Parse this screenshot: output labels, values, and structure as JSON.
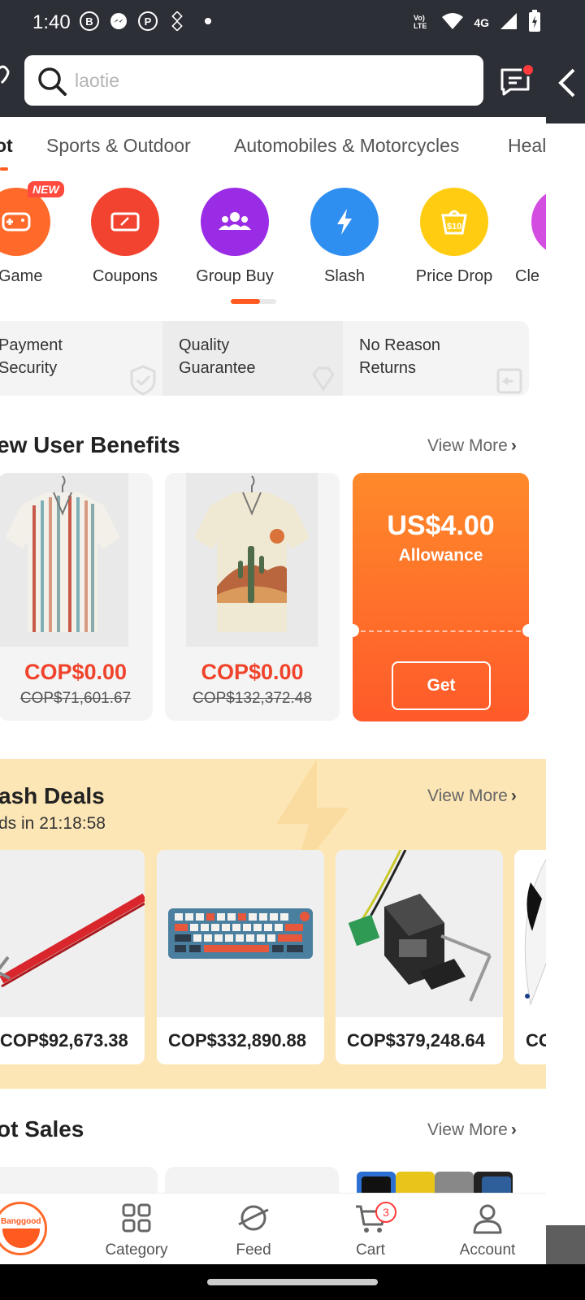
{
  "status_bar": {
    "time": "1:40",
    "network": "4G"
  },
  "search": {
    "placeholder": "laotie"
  },
  "category_tabs": [
    "ot",
    "Sports & Outdoor",
    "Automobiles & Motorcycles",
    "Heal"
  ],
  "quick_icons": [
    {
      "label": "Game",
      "color": "#ff6a2a",
      "badge": "NEW"
    },
    {
      "label": "Coupons",
      "color": "#f1432f"
    },
    {
      "label": "Group Buy",
      "color": "#9b2ce6"
    },
    {
      "label": "Slash",
      "color": "#2f8ff0"
    },
    {
      "label": "Price Drop",
      "color": "#ffcc12"
    },
    {
      "label": "Cle",
      "color": "#d34de0"
    }
  ],
  "guarantees": [
    {
      "line1": "Payment",
      "line2": "Security"
    },
    {
      "line1": "Quality",
      "line2": "Guarantee"
    },
    {
      "line1": "No Reason",
      "line2": "Returns"
    }
  ],
  "new_user": {
    "title": "ew User Benefits",
    "view_more": "View More",
    "items": [
      {
        "price": "COP$0.00",
        "old_price": "COP$71,601.67"
      },
      {
        "price": "COP$0.00",
        "old_price": "COP$132,372.48"
      }
    ],
    "allowance": {
      "amount": "US$4.00",
      "label": "Allowance",
      "button": "Get"
    }
  },
  "flash_deals": {
    "title": "ash Deals",
    "subtitle": "ds in 21:18:58",
    "view_more": "View More",
    "items": [
      {
        "price": "COP$92,673.38"
      },
      {
        "price": "COP$332,890.88"
      },
      {
        "price": "COP$379,248.64"
      },
      {
        "price": "CO"
      }
    ]
  },
  "hot_sales": {
    "title": "ot Sales",
    "view_more": "View More"
  },
  "bottom_nav": {
    "home_logo": "Banggood",
    "category": "Category",
    "feed": "Feed",
    "cart": "Cart",
    "cart_count": "3",
    "account": "Account"
  },
  "colors": {
    "accent": "#ff5a1f",
    "price": "#f0432b",
    "header": "#2d2f36"
  }
}
